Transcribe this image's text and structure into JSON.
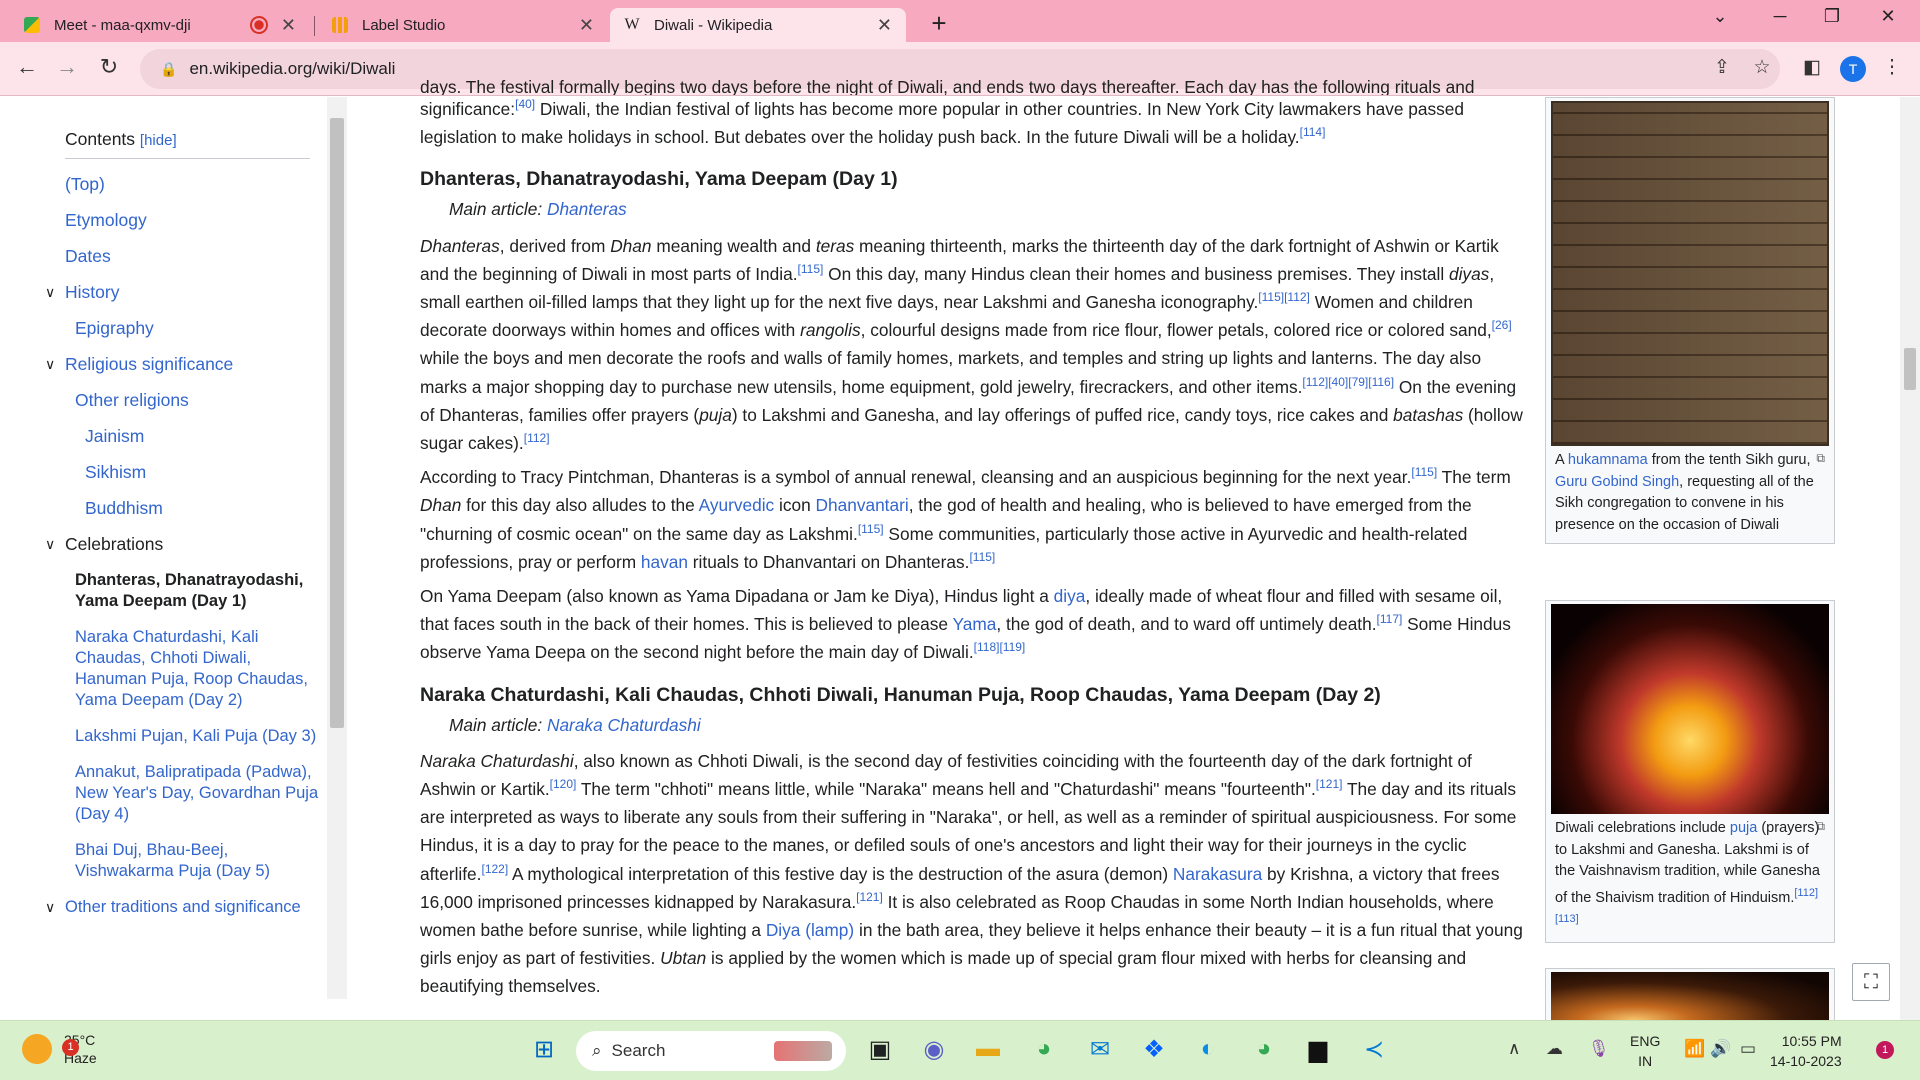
{
  "browser": {
    "tabs": [
      {
        "title": "Meet - maa-qxmv-dji",
        "active": false
      },
      {
        "title": "Label Studio",
        "active": false
      },
      {
        "title": "Diwali - Wikipedia",
        "active": true
      }
    ],
    "url": "en.wikipedia.org/wiki/Diwali"
  },
  "toc": {
    "title": "Contents",
    "hide": "[hide]",
    "items": [
      {
        "label": "(Top)"
      },
      {
        "label": "Etymology"
      },
      {
        "label": "Dates"
      },
      {
        "label": "History"
      },
      {
        "label": "Epigraphy"
      },
      {
        "label": "Religious significance"
      },
      {
        "label": "Other religions"
      },
      {
        "label": "Jainism"
      },
      {
        "label": "Sikhism"
      },
      {
        "label": "Buddhism"
      },
      {
        "label": "Celebrations"
      },
      {
        "label": "Dhanteras, Dhanatrayodashi, Yama Deepam (Day 1)"
      },
      {
        "label": "Naraka Chaturdashi, Kali Chaudas, Chhoti Diwali, Hanuman Puja, Roop Chaudas, Yama Deepam (Day 2)"
      },
      {
        "label": "Lakshmi Pujan, Kali Puja (Day 3)"
      },
      {
        "label": "Annakut, Balipratipada (Padwa), New Year's Day, Govardhan Puja (Day 4)"
      },
      {
        "label": "Bhai Duj, Bhau-Beej, Vishwakarma Puja (Day 5)"
      },
      {
        "label": "Other traditions and significance"
      }
    ]
  },
  "article": {
    "intro_cut": "days.  The festival formally begins two days before the night of Diwali, and ends two days thereafter. Each day has the following rituals and",
    "intro": {
      "a": "significance:",
      "r1": "[40]",
      "b": " Diwali, the Indian festival of lights has become more popular in other countries. In New York City lawmakers have passed legislation to make holidays in school. But debates over the holiday push back. In the future Diwali will be a holiday.",
      "r2": "[114]"
    },
    "h_day1": "Dhanteras, Dhanatrayodashi, Yama Deepam (Day 1)",
    "main_article_prefix": "Main article: ",
    "main_day1": "Dhanteras",
    "p1": {
      "t1": "Dhanteras",
      "t2": ", derived from ",
      "t3": "Dhan",
      "t4": " meaning wealth and ",
      "t5": "teras",
      "t6": " meaning thirteenth, marks the thirteenth day of the dark fortnight of Ashwin or Kartik and the beginning of Diwali in most parts of India.",
      "r1": "[115]",
      "t7": " On this day, many Hindus clean their homes and business premises. They install ",
      "t8": "diyas",
      "t9": ", small earthen oil-filled lamps that they light up for the next five days, near Lakshmi and Ganesha iconography.",
      "r2": "[115][112]",
      "t10": " Women and children decorate doorways within homes and offices with ",
      "t11": "rangolis",
      "t12": ", colourful designs made from rice flour, flower petals, colored rice or colored sand,",
      "r3": "[26]",
      "t13": " while the boys and men decorate the roofs and walls of family homes, markets, and temples and string up lights and lanterns. The day also marks a major shopping day to purchase new utensils, home equipment, gold jewelry, firecrackers, and other items.",
      "r4": "[112][40][79][116]",
      "t14": " On the evening of Dhanteras, families offer prayers (",
      "t15": "puja",
      "t16": ") to Lakshmi and Ganesha, and lay offerings of puffed rice, candy toys, rice cakes and ",
      "t17": "batashas",
      "t18": " (hollow sugar cakes).",
      "r5": "[112]"
    },
    "p2": {
      "t1": "According to Tracy Pintchman, Dhanteras is a symbol of annual renewal, cleansing and an auspicious beginning for the next year.",
      "r1": "[115]",
      "t2": " The term ",
      "t3": "Dhan",
      "t4": " for this day also alludes to the ",
      "l1": "Ayurvedic",
      "t5": " icon ",
      "l2": "Dhanvantari",
      "t6": ", the god of health and healing, who is believed to have emerged from the \"churning of cosmic ocean\" on the same day as Lakshmi.",
      "r2": "[115]",
      "t7": " Some communities, particularly those active in Ayurvedic and health-related professions, pray or perform ",
      "l3": "havan",
      "t8": " rituals to Dhanvantari on Dhanteras.",
      "r3": "[115]"
    },
    "p3": {
      "t1": "On Yama Deepam (also known as Yama Dipadana or Jam ke Diya), Hindus light a ",
      "l1": "diya",
      "t2": ", ideally made of wheat flour and filled with sesame oil, that faces south in the back of their homes. This is believed to please ",
      "l2": "Yama",
      "t3": ", the god of death, and to ward off untimely death.",
      "r1": "[117]",
      "t4": " Some Hindus observe Yama Deepa on the second night before the main day of Diwali.",
      "r2": "[118][119]"
    },
    "h_day2": "Naraka Chaturdashi, Kali Chaudas, Chhoti Diwali, Hanuman Puja, Roop Chaudas, Yama Deepam (Day 2)",
    "main_day2": "Naraka Chaturdashi",
    "p4": {
      "t1": "Naraka Chaturdashi",
      "t2": ", also known as Chhoti Diwali, is the second day of festivities coinciding with the fourteenth day of the dark fortnight of Ashwin or Kartik.",
      "r1": "[120]",
      "t3": " The term \"chhoti\" means little, while \"Naraka\" means hell and \"Chaturdashi\" means \"fourteenth\".",
      "r2": "[121]",
      "t4": " The day and its rituals are interpreted as ways to liberate any souls from their suffering in \"Naraka\", or hell, as well as a reminder of spiritual auspiciousness. For some Hindus, it is a day to pray for the peace to the manes, or defiled souls of one's ancestors and light their way for their journeys in the cyclic afterlife.",
      "r3": "[122]",
      "t5": " A mythological interpretation of this festive day is the destruction of the asura (demon) ",
      "l1": "Narakasura",
      "t6": " by Krishna, a victory that frees 16,000 imprisoned princesses kidnapped by Narakasura.",
      "r4": "[121]",
      "t7": " It is also celebrated as Roop Chaudas in some North Indian households, where women bathe before sunrise, while lighting a ",
      "l2": "Diya (lamp)",
      "t8": " in the bath area, they believe it helps enhance their beauty – it is a fun ritual that young girls enjoy as part of festivities. ",
      "t9": "Ubtan",
      "t10": " is applied by the women which is made up of special gram flour mixed with herbs for cleansing and beautifying themselves."
    }
  },
  "figures": {
    "f1": {
      "a": "A ",
      "l1": "hukamnama",
      "b": " from the tenth Sikh guru, ",
      "l2": "Guru Gobind Singh",
      "c": ", requesting all of the Sikh congregation to convene in his presence on the occasion of Diwali"
    },
    "f2": {
      "a": "Diwali celebrations include ",
      "l1": "puja",
      "b": " (prayers) to Lakshmi and Ganesha. Lakshmi is of the Vaishnavism tradition, while Ganesha of the Shaivism tradition of Hinduism.",
      "r": "[112][113]"
    }
  },
  "taskbar": {
    "temp": "25°C",
    "weather": "Haze",
    "weather_badge": "1",
    "search_placeholder": "Search",
    "lang1": "ENG",
    "lang2": "IN",
    "time": "10:55 PM",
    "date": "14-10-2023",
    "notif_count": "1"
  },
  "colors": {
    "tab_bar": "#f7a9bf",
    "link": "#3366cc",
    "taskbar": "#d9f0cc"
  }
}
